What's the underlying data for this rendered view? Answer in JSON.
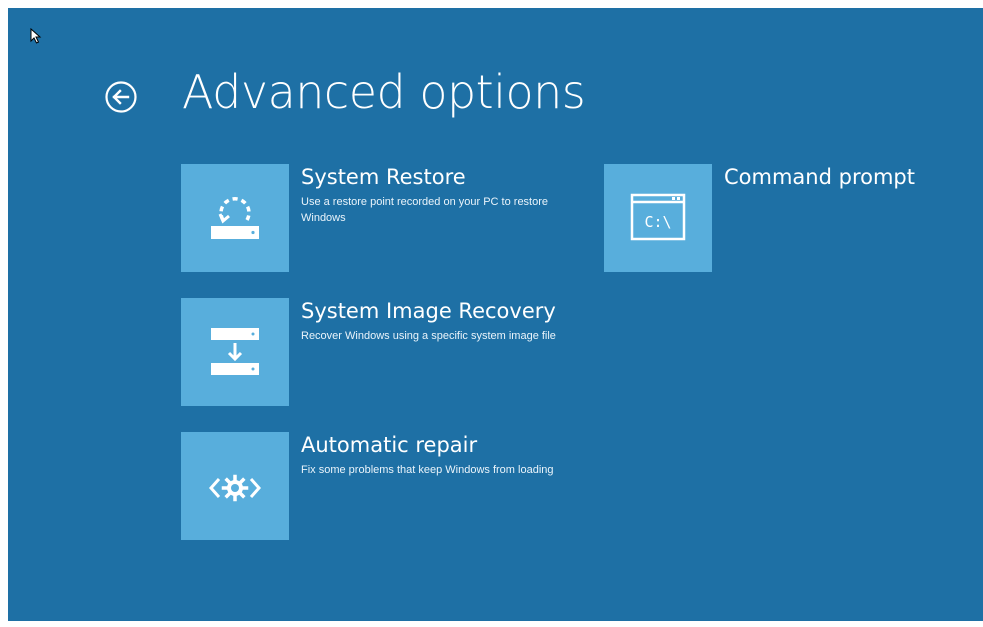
{
  "page": {
    "title": "Advanced options",
    "background_color": "#1e70a5",
    "tile_color": "#58aedc"
  },
  "back_button": {
    "icon": "back-arrow-circle-icon"
  },
  "options": [
    {
      "title": "System Restore",
      "description": "Use a restore point recorded on your PC to restore Windows",
      "icon": "system-restore-icon"
    },
    {
      "title": "System Image Recovery",
      "description": "Recover Windows using a specific system image file",
      "icon": "system-image-recovery-icon"
    },
    {
      "title": "Automatic repair",
      "description": "Fix some problems that keep Windows from loading",
      "icon": "automatic-repair-icon"
    },
    {
      "title": "Command prompt",
      "description": "",
      "icon": "command-prompt-icon",
      "icon_text": "C:\\"
    }
  ]
}
